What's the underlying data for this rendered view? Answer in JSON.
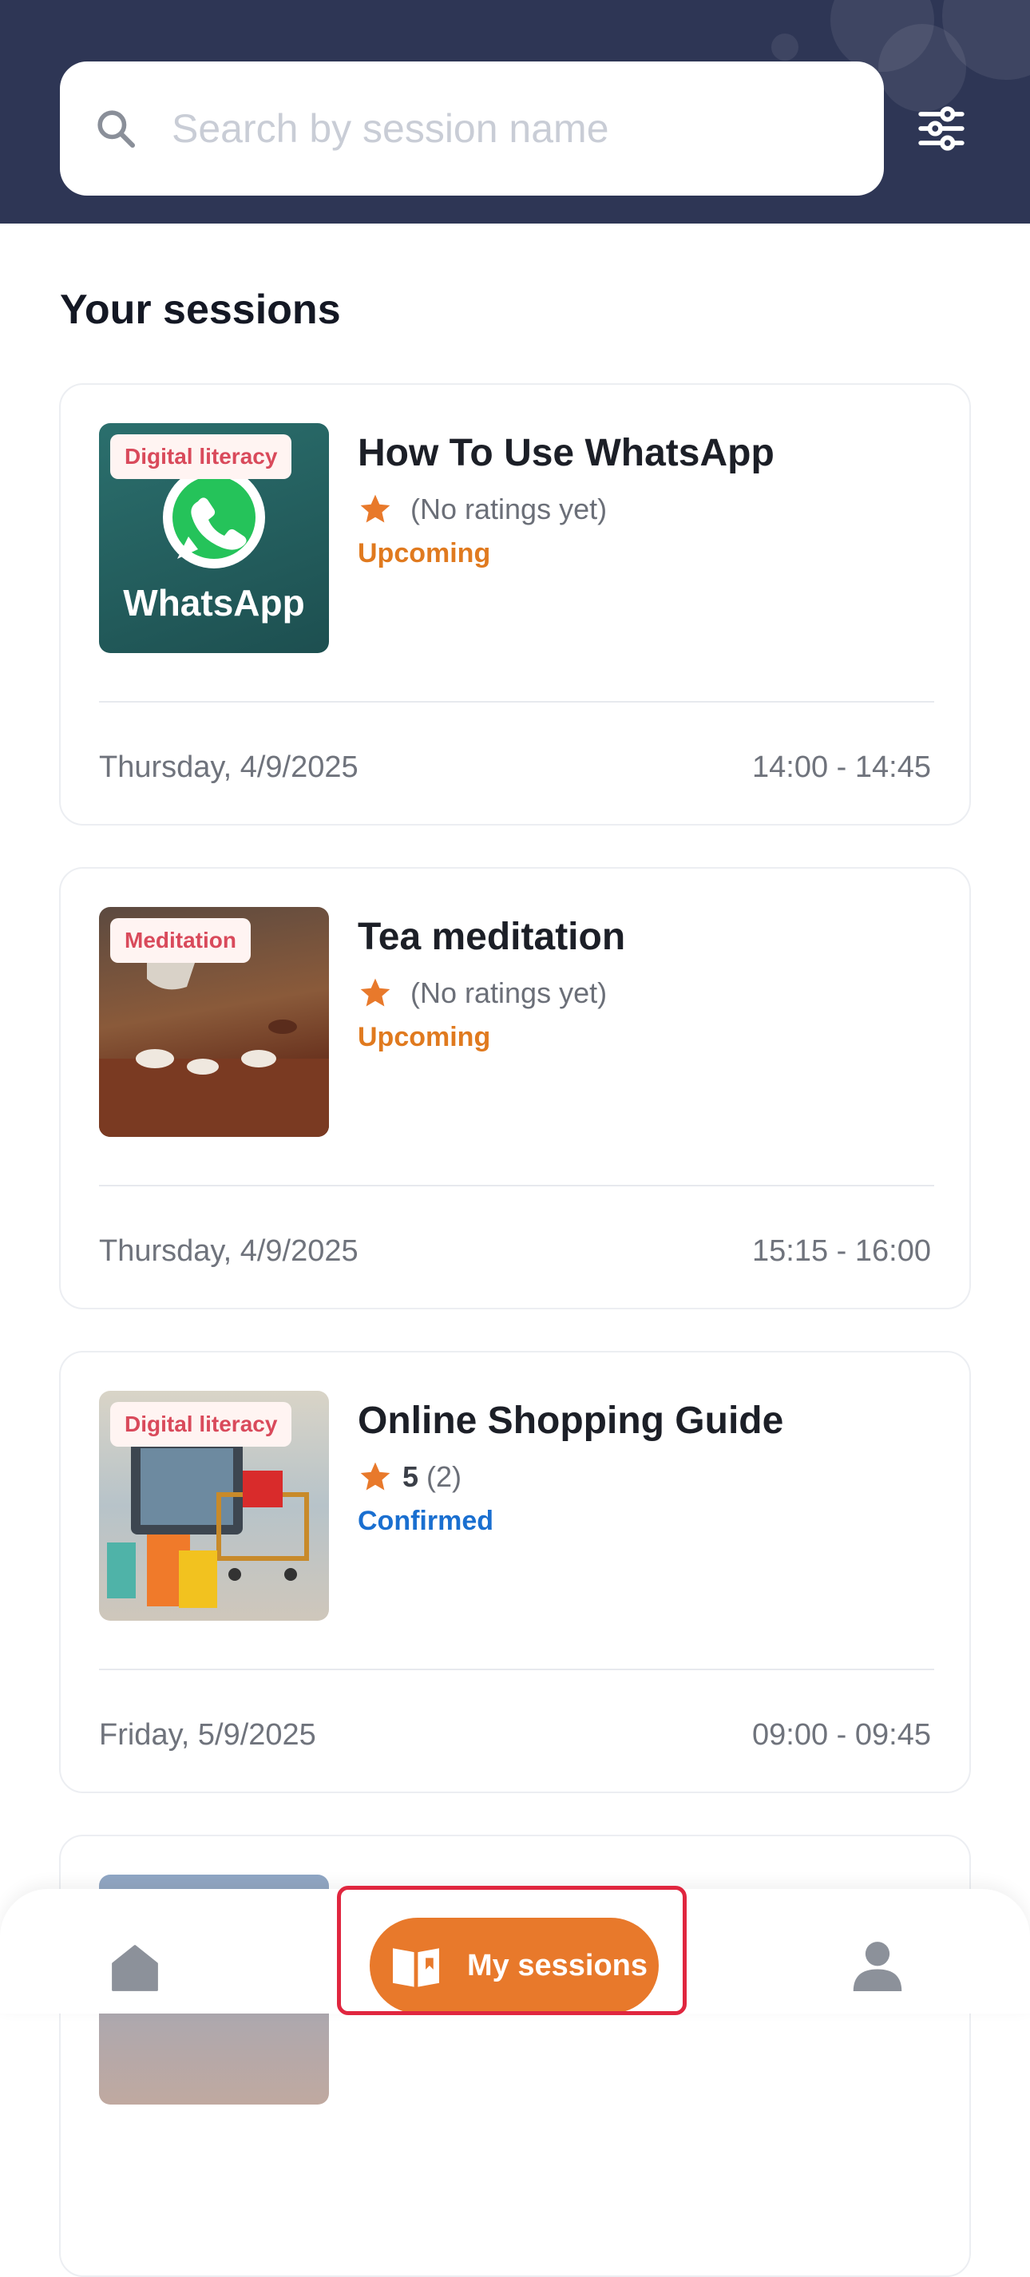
{
  "search": {
    "placeholder": "Search by session name"
  },
  "section_title": "Your sessions",
  "sessions": [
    {
      "tag": "Digital literacy",
      "title": "How To Use WhatsApp",
      "rating_score": "",
      "rating_text": "(No ratings yet)",
      "status": "Upcoming",
      "status_color": "#e07a1f",
      "date": "Thursday, 4/9/2025",
      "time": "14:00 - 14:45",
      "thumb_text": "WhatsApp"
    },
    {
      "tag": "Meditation",
      "title": "Tea meditation",
      "rating_score": "",
      "rating_text": "(No ratings yet)",
      "status": "Upcoming",
      "status_color": "#e07a1f",
      "date": "Thursday, 4/9/2025",
      "time": "15:15 - 16:00"
    },
    {
      "tag": "Digital literacy",
      "title": "Online Shopping Guide",
      "rating_score": "5",
      "rating_text": "(2)",
      "status": "Confirmed",
      "status_color": "#1a6fd0",
      "date": "Friday, 5/9/2025",
      "time": "09:00 - 09:45"
    }
  ],
  "nav": {
    "active_label": "My sessions",
    "accent": "#e8792b",
    "items": [
      "home-icon",
      "book-open-icon",
      "person-icon"
    ]
  },
  "colors": {
    "header_bg": "#2e3655",
    "highlight": "#e0263f"
  }
}
